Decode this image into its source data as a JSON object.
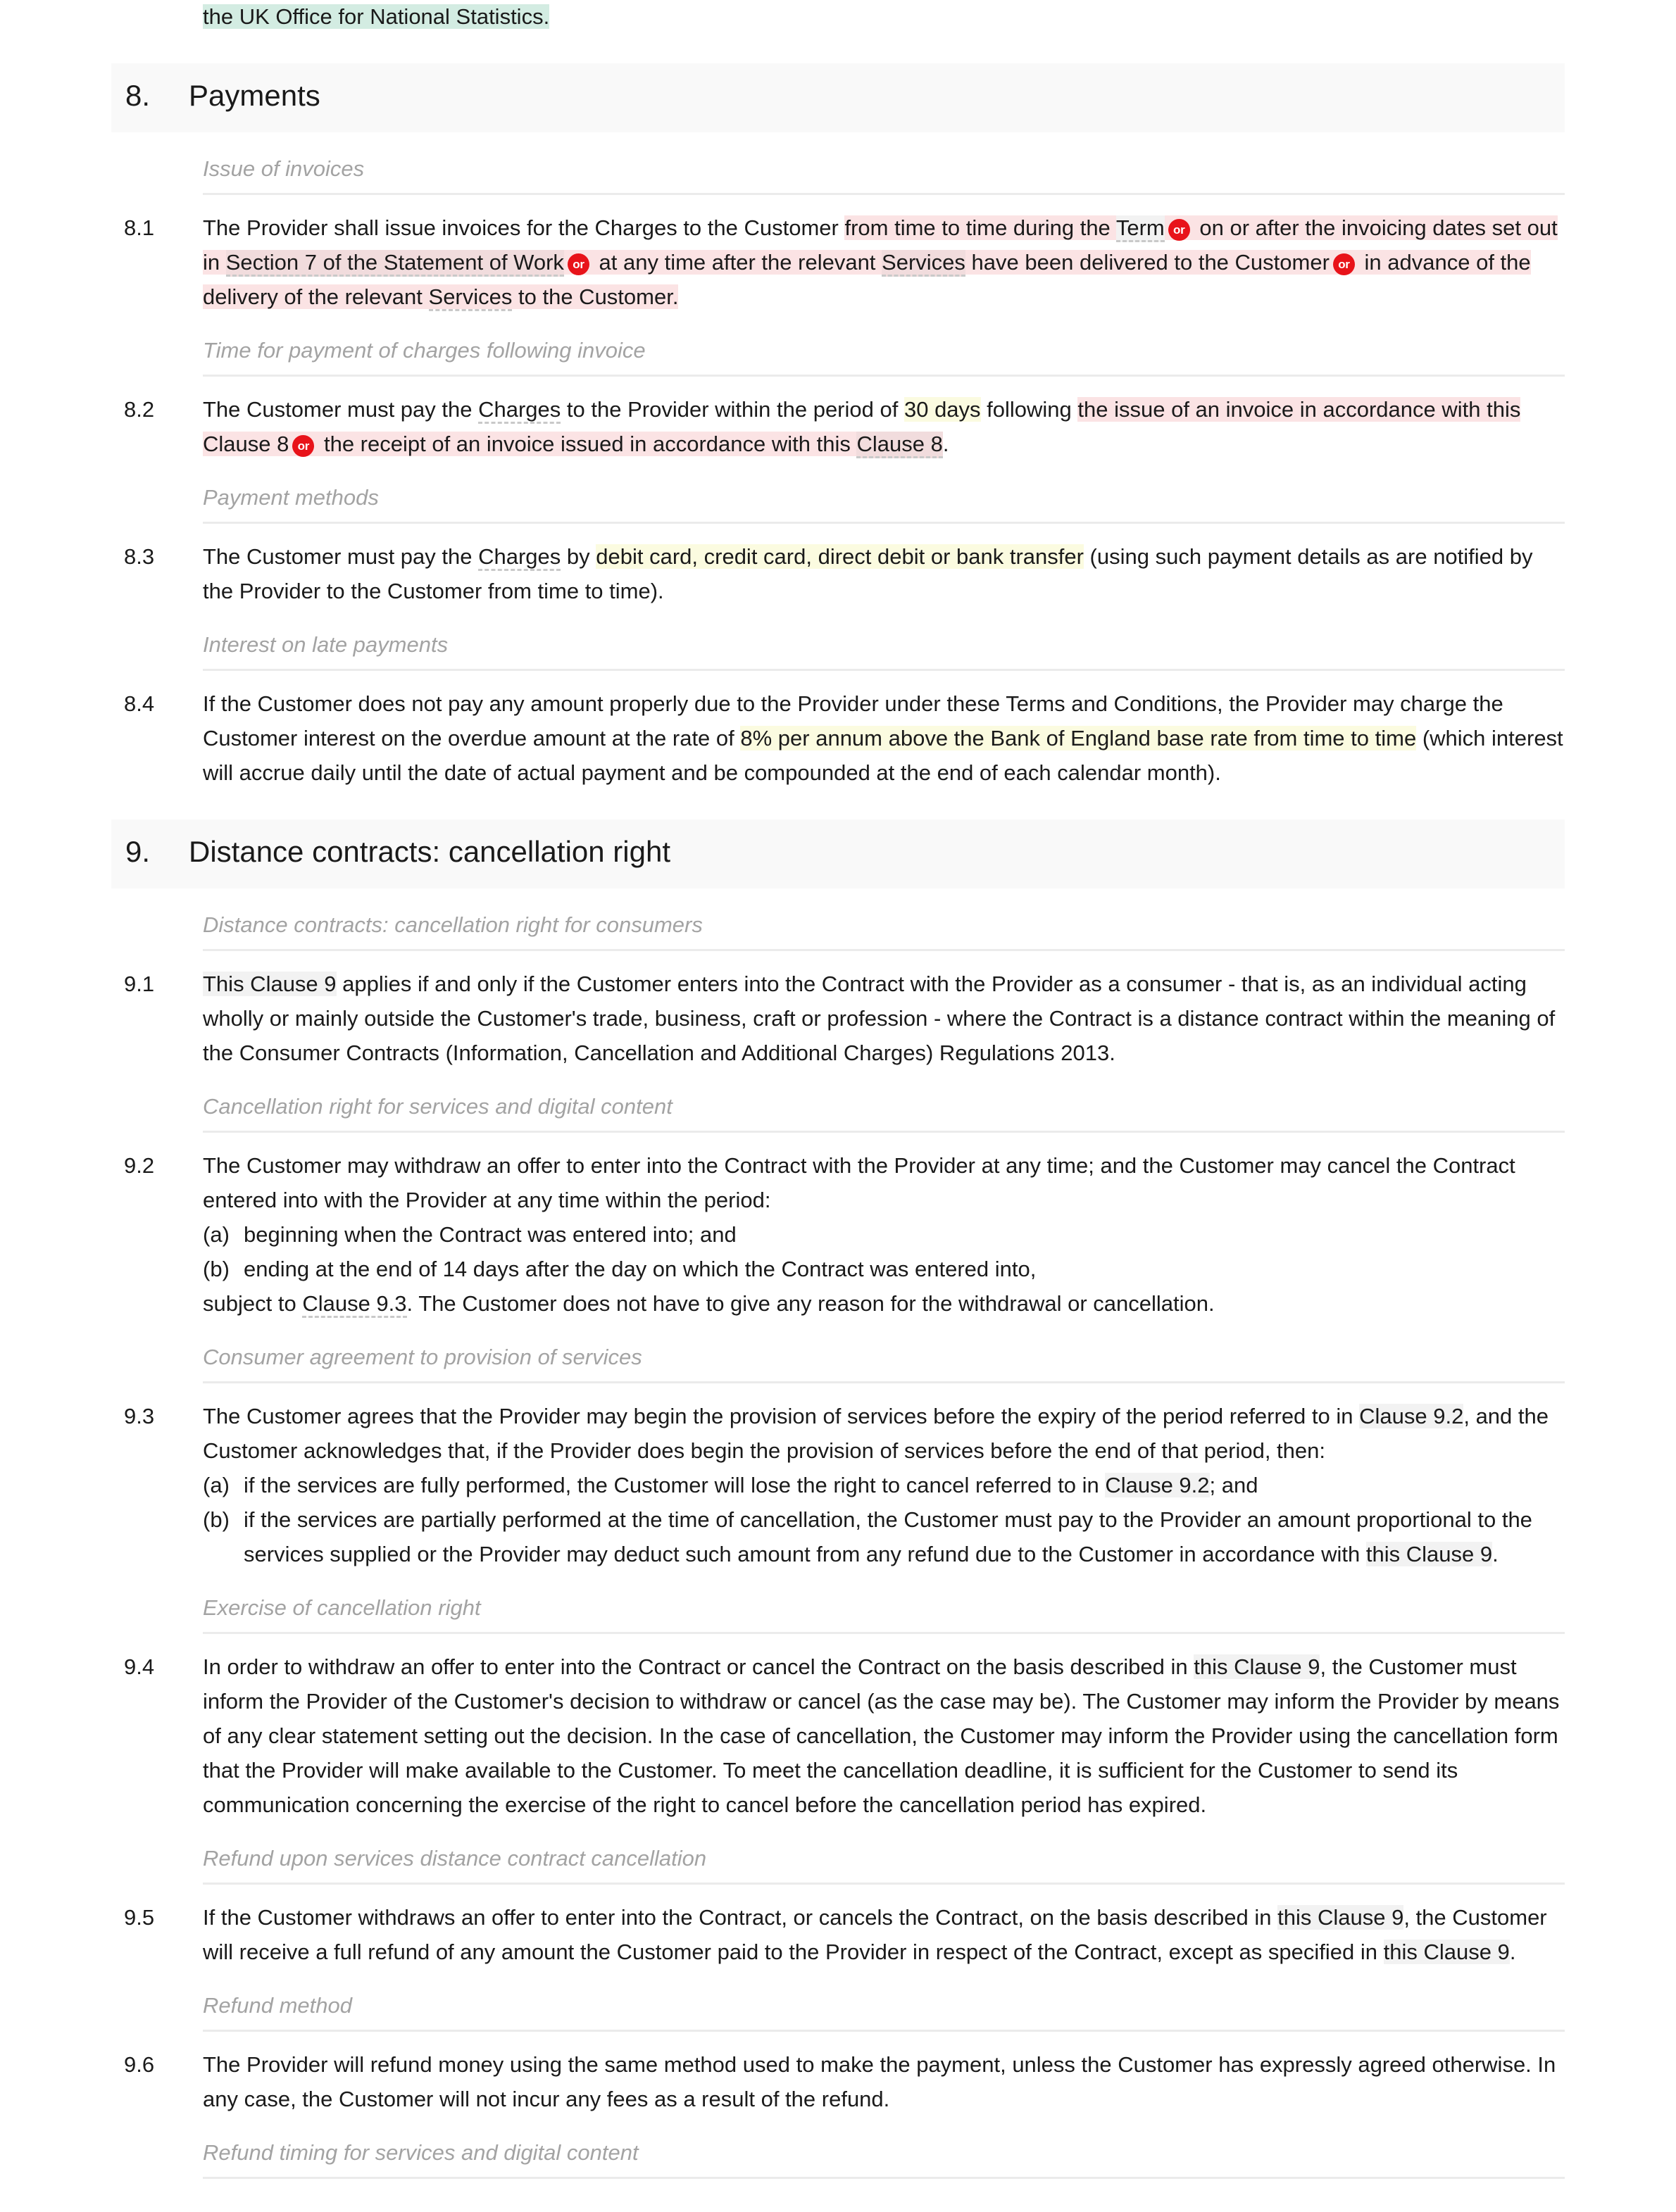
{
  "continuation": {
    "highlighted_text": "the UK Office for National Statistics."
  },
  "colors": {
    "highlight_teal": "#d3ece2",
    "highlight_yellow": "#fbfbe0",
    "highlight_pink": "#fbe3e4",
    "highlight_pink_overlap": "#f1dcdd",
    "cross_reference_grey": "#f2f2f2",
    "or_chip_red": "#e8131a",
    "section_band": "#f9f9f9",
    "rule": "#ebebeb",
    "subheading_text": "#a3a3a3",
    "body_text": "#1a1a1a"
  },
  "or_chip_label": "or",
  "sections": [
    {
      "number": "8.",
      "title": "Payments"
    },
    {
      "number": "9.",
      "title": "Distance contracts: cancellation right"
    }
  ],
  "subheadings": {
    "issue_of_invoices": "Issue of invoices",
    "time_for_payment": "Time for payment of charges following invoice",
    "payment_methods": "Payment methods",
    "interest_on_late_payments": "Interest on late payments",
    "distance_contracts_consumers": "Distance contracts: cancellation right for consumers",
    "cancellation_right_services": "Cancellation right for services and digital content",
    "consumer_agreement": "Consumer agreement to provision of services",
    "exercise_of_cancellation": "Exercise of cancellation right",
    "refund_upon_cancellation": "Refund upon services distance contract cancellation",
    "refund_method": "Refund method",
    "refund_timing": "Refund timing for services and digital content"
  },
  "clauses": {
    "c81": {
      "number": "8.1",
      "t1": "The Provider shall issue invoices for the Charges to the Customer ",
      "t2": "from time to time during the ",
      "t3": "Term",
      "t4": " on or after the invoicing dates set out in ",
      "t5": "Section 7 of the Statement of Work",
      "t6": " at any time after the relevant ",
      "t7": "Services",
      "t8": " have been delivered to the Customer",
      "t9": " in advance of the delivery of the relevant ",
      "t10": "Services",
      "t11": " to the Customer."
    },
    "c82": {
      "number": "8.2",
      "t1": "The Customer must pay the ",
      "t2": "Charges",
      "t3": " to the Provider within the period of ",
      "t4": "30 days",
      "t5": " following ",
      "t6": "the issue of an invoice in accordance with this Clause 8",
      "t7": " the receipt of an invoice issued in accordance with this ",
      "t8": "Clause 8",
      "t9": "."
    },
    "c83": {
      "number": "8.3",
      "t1": "The Customer must pay the ",
      "t2": "Charges",
      "t3": " by ",
      "t4": "debit card, credit card, direct debit or bank transfer",
      "t5": " (using such payment details as are notified by the Provider to the Customer from time to time)."
    },
    "c84": {
      "number": "8.4",
      "t1": "If the Customer does not pay any amount properly due to the Provider under these Terms and Conditions, the Provider may charge the Customer interest on the overdue amount at the rate of ",
      "t2": "8% per annum above the Bank of England base rate from time to time",
      "t3": " (which interest will accrue daily until the date of actual payment and be compounded at the end of each calendar month)."
    },
    "c91": {
      "number": "9.1",
      "t1": "This Clause 9",
      "t2": " applies if and only if the Customer enters into the Contract with the Provider as a consumer - that is, as an individual acting wholly or mainly outside the Customer's trade, business, craft or profession - where the Contract is a distance contract within the meaning of the Consumer Contracts (Information, Cancellation and Additional Charges) Regulations 2013."
    },
    "c92": {
      "number": "9.2",
      "intro": "The Customer may withdraw an offer to enter into the Contract with the Provider at any time; and the Customer may cancel the Contract entered into with the Provider at any time within the period:",
      "items": [
        {
          "marker": "(a)",
          "text": "beginning when the Contract was entered into; and"
        },
        {
          "marker": "(b)",
          "text": "ending at the end of 14 days after the day on which the Contract was entered into,"
        }
      ],
      "tail_1": "subject to ",
      "tail_2": "Clause 9.3",
      "tail_3": ". The Customer does not have to give any reason for the withdrawal or cancellation."
    },
    "c93": {
      "number": "9.3",
      "i1": "The Customer agrees that the Provider may begin the provision of services before the expiry of the period referred to in ",
      "i2": "Clause 9.2",
      "i3": ", and the Customer acknowledges that, if the Provider does begin the provision of services before the end of that period, then:",
      "a_marker": "(a)",
      "a1": "if the services are fully performed, the Customer will lose the right to cancel referred to in ",
      "a2": "Clause 9.2",
      "a3": "; and",
      "b_marker": "(b)",
      "b1": "if the services are partially performed at the time of cancellation, the Customer must pay to the Provider an amount proportional to the services supplied or the Provider may deduct such amount from any refund due to the Customer in accordance with ",
      "b2": "this Clause 9",
      "b3": "."
    },
    "c94": {
      "number": "9.4",
      "t1": "In order to withdraw an offer to enter into the Contract or cancel the Contract on the basis described in ",
      "t2": "this Clause 9",
      "t3": ", the Customer must inform the Provider of the Customer's decision to withdraw or cancel (as the case may be). The Customer may inform the Provider by means of any clear statement setting out the decision. In the case of cancellation, the Customer may inform the Provider using the cancellation form that the Provider will make available to the Customer. To meet the cancellation deadline, it is sufficient for the Customer to send its communication concerning the exercise of the right to cancel before the cancellation period has expired."
    },
    "c95": {
      "number": "9.5",
      "t1": "If the Customer withdraws an offer to enter into the Contract, or cancels the Contract, on the basis described in ",
      "t2": "this Clause 9",
      "t3": ", the Customer will receive a full refund of any amount the Customer paid to the Provider in respect of the Contract, except as specified in ",
      "t4": "this Clause 9",
      "t5": "."
    },
    "c96": {
      "number": "9.6",
      "t1": "The Provider will refund money using the same method used to make the payment, unless the Customer has expressly agreed otherwise. In any case, the Customer will not incur any fees as a result of the refund."
    }
  }
}
